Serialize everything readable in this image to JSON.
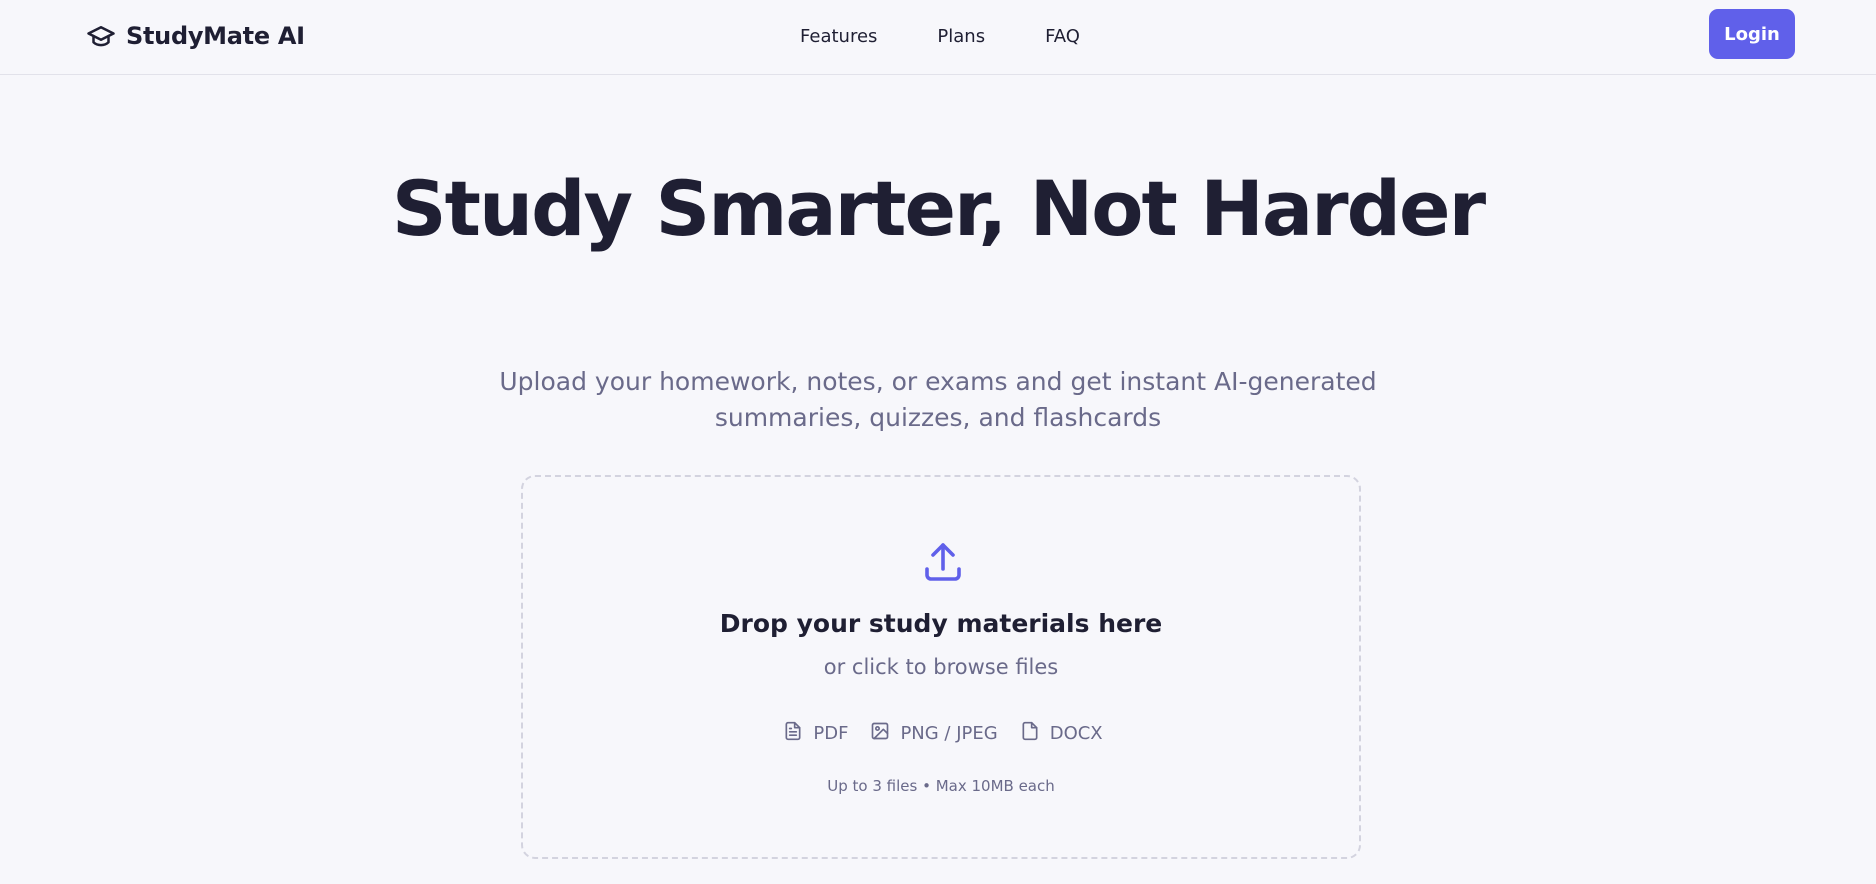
{
  "header": {
    "brand_name": "StudyMate AI",
    "brand_icon": "graduation-cap-icon",
    "nav": [
      {
        "label": "Features"
      },
      {
        "label": "Plans"
      },
      {
        "label": "FAQ"
      }
    ],
    "login_label": "Login"
  },
  "hero": {
    "title": "Study Smarter, Not Harder",
    "subtitle": "Upload your homework, notes, or exams and get instant AI-generated summaries, quizzes, and flashcards"
  },
  "dropzone": {
    "icon": "upload-icon",
    "title": "Drop your study materials here",
    "subtitle": "or click to browse files",
    "formats": [
      {
        "label": "PDF",
        "icon": "document-icon"
      },
      {
        "label": "PNG / JPEG",
        "icon": "image-icon"
      },
      {
        "label": "DOCX",
        "icon": "file-icon"
      }
    ],
    "limits": "Up to 3 files • Max 10MB each"
  },
  "colors": {
    "accent": "#6060ea",
    "background": "#f7f7fb",
    "text": "#1f1f33",
    "muted": "#6a6a8a"
  }
}
